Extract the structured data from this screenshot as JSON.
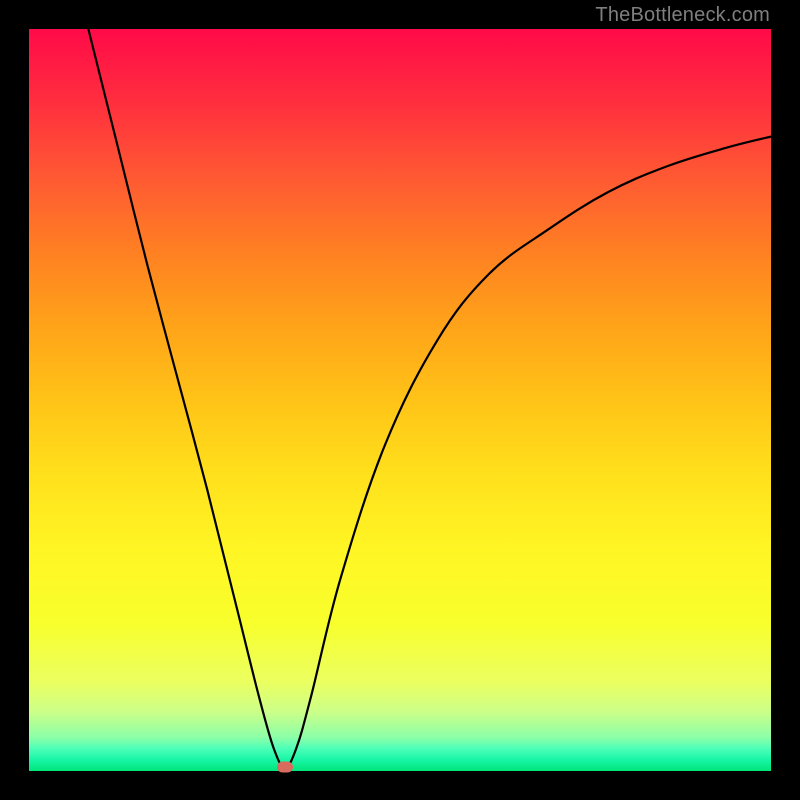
{
  "attribution": "TheBottleneck.com",
  "colors": {
    "background": "#000000",
    "curve": "#000000",
    "marker": "#d86b5e",
    "attribution_text": "#7f7f7f"
  },
  "chart_data": {
    "type": "line",
    "title": "",
    "xlabel": "",
    "ylabel": "",
    "xlim": [
      0,
      100
    ],
    "ylim": [
      0,
      100
    ],
    "grid": false,
    "legend": false,
    "series": [
      {
        "name": "bottleneck-curve",
        "x": [
          8,
          12,
          16,
          20,
          24,
          28,
          31,
          33,
          34.5,
          36,
          38,
          42,
          48,
          55,
          62,
          70,
          78,
          86,
          94,
          100
        ],
        "y": [
          100,
          84,
          68,
          53,
          38,
          22,
          10,
          3,
          0.5,
          3,
          10,
          26,
          44,
          58,
          67,
          73,
          78,
          81.5,
          84,
          85.5
        ]
      }
    ],
    "marker": {
      "x": 34.5,
      "y": 0.5
    },
    "note": "x/y are percentages of plot-area width/height; y increases upward from the green band (0) to the red top (100)."
  }
}
